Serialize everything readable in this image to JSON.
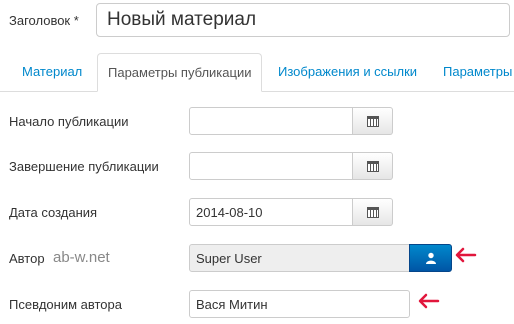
{
  "title_field": {
    "label": "Заголовок *",
    "value": "Новый материал"
  },
  "tabs": [
    {
      "label": "Материал",
      "active": false
    },
    {
      "label": "Параметры публикации",
      "active": true
    },
    {
      "label": "Изображения и ссылки",
      "active": false
    },
    {
      "label": "Параметры",
      "active": false
    }
  ],
  "fields": {
    "publish_up": {
      "label": "Начало публикации",
      "value": ""
    },
    "publish_down": {
      "label": "Завершение публикации",
      "value": ""
    },
    "created": {
      "label": "Дата создания",
      "value": "2014-08-10"
    },
    "author": {
      "label": "Автор",
      "watermark": "ab-w.net",
      "value": "Super User"
    },
    "alias": {
      "label": "Псевдоним автора",
      "value": "Вася Митин"
    }
  },
  "annotation": {
    "arrow_glyph": "🡐",
    "color": "#e1163c"
  },
  "icons": {
    "calendar": "calendar-icon",
    "user": "user-icon"
  }
}
